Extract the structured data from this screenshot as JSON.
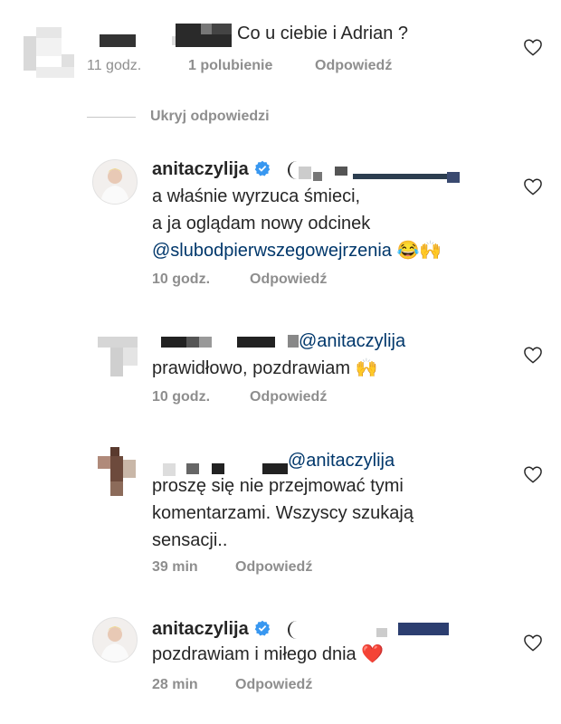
{
  "comments": [
    {
      "text": "Co u ciebie i Adrian ?",
      "time": "11 godz.",
      "likes": "1 polubienie",
      "reply": "Odpowiedź"
    }
  ],
  "hide_replies": "Ukryj odpowiedzi",
  "replies": [
    {
      "username": "anitaczylija",
      "verified": true,
      "lines": [
        "a właśnie wyrzuca śmieci,",
        "a ja oglądam nowy odcinek"
      ],
      "mention_link": "@slubodpierwszegowejrzenia",
      "emoji": "😂🙌",
      "time": "10 godz.",
      "reply": "Odpowiedź"
    },
    {
      "mention": "@anitaczylija",
      "lines": [
        "prawidłowo, pozdrawiam"
      ],
      "emoji": "🙌",
      "time": "10 godz.",
      "reply": "Odpowiedź"
    },
    {
      "mention": "@anitaczylija",
      "lines": [
        "proszę się nie przejmować tymi",
        "komentarzami. Wszyscy szukają",
        "sensacji.."
      ],
      "time": "39 min",
      "reply": "Odpowiedź"
    },
    {
      "username": "anitaczylija",
      "verified": true,
      "lines": [
        "pozdrawiam i miłego dnia"
      ],
      "emoji": "❤️",
      "time": "28 min",
      "reply": "Odpowiedź"
    }
  ],
  "colors": {
    "verified": "#3897f0",
    "link": "#00376b",
    "meta": "#8e8e8e",
    "heart": "#e0245e"
  },
  "icons": [
    "heart-outline-icon",
    "verified-badge-icon",
    "heart-emoji",
    "raising-hands-emoji",
    "laughing-emoji"
  ]
}
